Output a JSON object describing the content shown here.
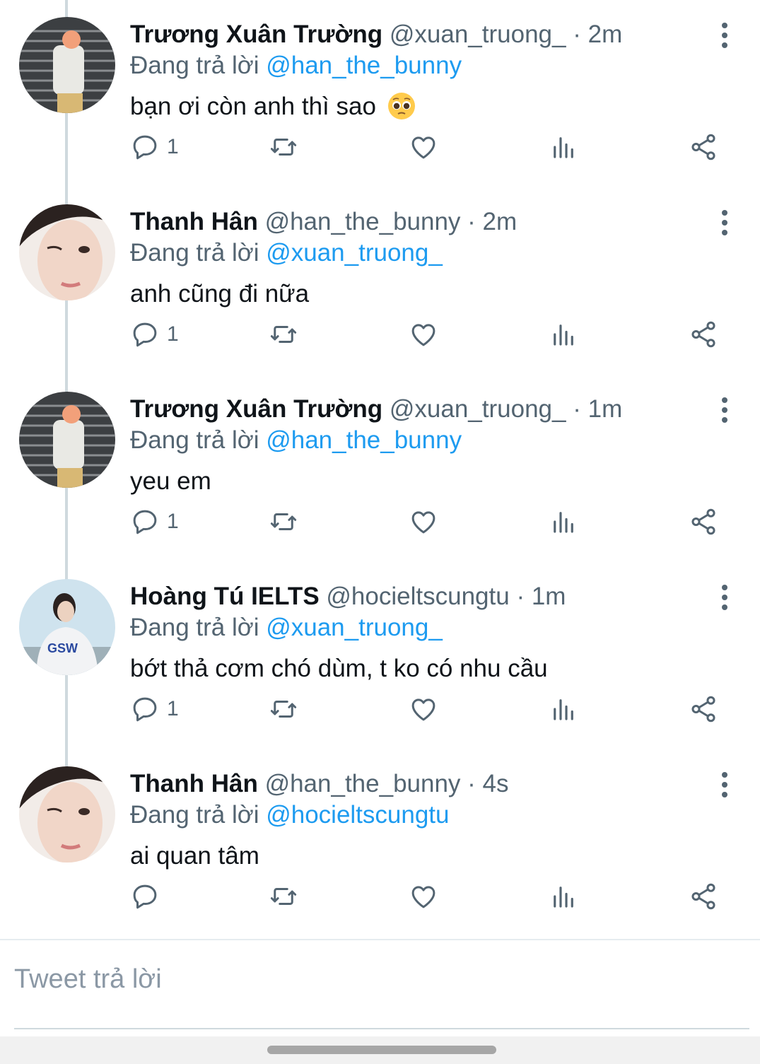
{
  "reply_prefix": "Đang trả lời",
  "tweets": [
    {
      "name": "Trương Xuân Trường",
      "handle": "@xuan_truong_",
      "time": "· 2m",
      "reply_to": "@han_the_bunny",
      "text": "bạn ơi còn anh thì sao",
      "emoji": "pleading-face-emoji",
      "replies": "1"
    },
    {
      "name": "Thanh Hân",
      "handle": "@han_the_bunny",
      "time": "· 2m",
      "reply_to": "@xuan_truong_",
      "text": "anh cũng đi nữa",
      "replies": "1"
    },
    {
      "name": "Trương Xuân Trường",
      "handle": "@xuan_truong_",
      "time": "· 1m",
      "reply_to": "@han_the_bunny",
      "text": "yeu em",
      "replies": "1"
    },
    {
      "name": "Hoàng Tú IELTS",
      "handle": "@hocieltscungtu",
      "time": "· 1m",
      "reply_to": "@xuan_truong_",
      "text": "bớt thả cơm chó dùm, t ko có nhu cầu",
      "replies": "1"
    },
    {
      "name": "Thanh Hân",
      "handle": "@han_the_bunny",
      "time": "· 4s",
      "reply_to": "@hocieltscungtu",
      "text": "ai quan tâm",
      "replies": ""
    }
  ],
  "composer": {
    "placeholder": "Tweet trả lời"
  },
  "icons": {
    "reply": "reply-icon",
    "retweet": "retweet-icon",
    "like": "heart-icon",
    "analytics": "analytics-icon",
    "share": "share-icon",
    "more": "more-vertical-icon"
  },
  "colors": {
    "accent": "#1d9bf0",
    "secondary_text": "#536471",
    "icon": "#536471"
  }
}
